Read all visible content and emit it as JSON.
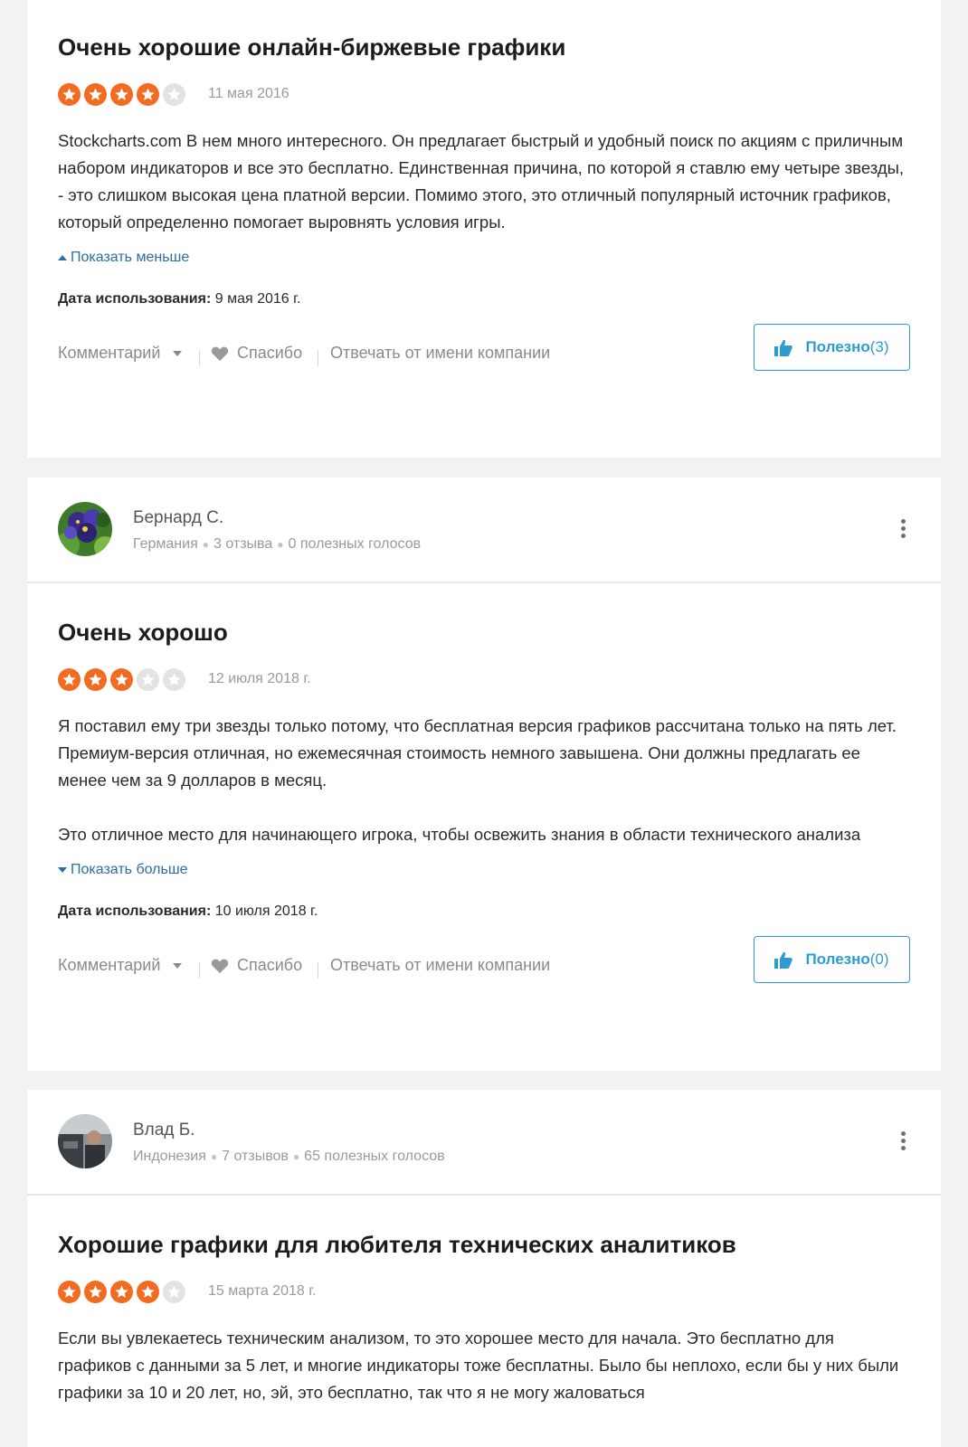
{
  "review1": {
    "title": "Очень хорошие онлайн-биржевые графики",
    "stars_filled": 4,
    "date": "11 мая 2016",
    "paragraphs": [
      "Stockcharts.com В нем много интересного. Он предлагает быстрый и удобный поиск по акциям с приличным набором индикаторов и все это бесплатно. Единственная причина, по которой я ставлю ему четыре звезды, - это слишком высокая цена платной версии. Помимо этого, это отличный популярный источник графиков, который определенно помогает выровнять условия игры."
    ],
    "toggle": "Показать меньше",
    "usage_label": "Дата использования:",
    "usage_date": "9 мая 2016 г.",
    "comment": "Комментарий",
    "thanks": "Спасибо",
    "reply": "Отвечать от имени компании",
    "helpful": "Полезно",
    "helpful_count": "(3)"
  },
  "review2": {
    "reviewer_name": "Бернард С.",
    "country": "Германия",
    "reviews_count": "3 отзыва",
    "votes": "0 полезных голосов",
    "title": "Очень хорошо",
    "stars_filled": 3,
    "date": "12 июля 2018 г.",
    "paragraphs": [
      "Я поставил ему три звезды только потому, что бесплатная версия графиков рассчитана только на пять лет. Премиум-версия отличная, но ежемесячная стоимость немного завышена. Они должны предлагать ее менее чем за 9 долларов в месяц.",
      "Это отличное место для начинающего игрока, чтобы освежить знания в области технического анализа"
    ],
    "toggle": "Показать больше",
    "usage_label": "Дата использования:",
    "usage_date": "10 июля 2018 г.",
    "comment": "Комментарий",
    "thanks": "Спасибо",
    "reply": "Отвечать от имени компании",
    "helpful": "Полезно",
    "helpful_count": "(0)"
  },
  "review3": {
    "reviewer_name": "Влад Б.",
    "country": "Индонезия",
    "reviews_count": "7 отзывов",
    "votes": "65 полезных голосов",
    "title": "Хорошие графики для любителя технических аналитиков",
    "stars_filled": 4,
    "date": "15 марта 2018 г.",
    "paragraphs": [
      "Если вы увлекаетесь техническим анализом, то это хорошее место для начала. Это бесплатно для графиков с данными за 5 лет, и многие индикаторы тоже бесплатны. Было бы неплохо, если бы у них были графики за 10 и 20 лет, но, эй, это бесплатно, так что я не могу жаловаться"
    ]
  },
  "colors": {
    "star": "#f26b21",
    "star_empty": "#e3e3e3",
    "link": "#2a6ea6",
    "helpful": "#2e9bd0"
  }
}
